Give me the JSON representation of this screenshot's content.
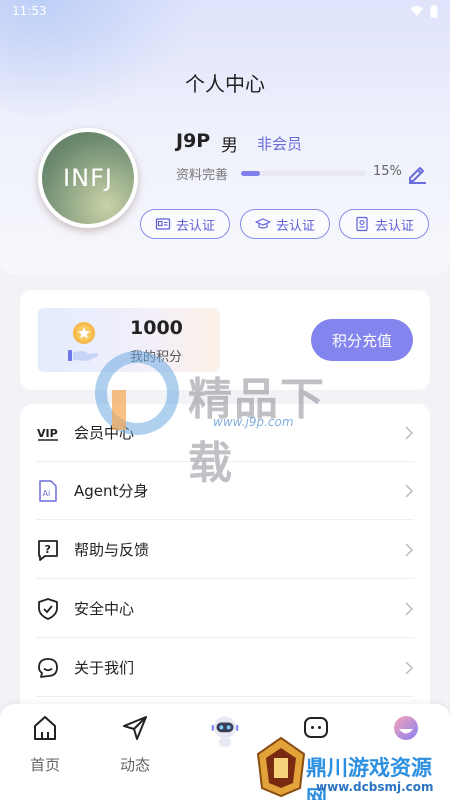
{
  "status_bar": {
    "time": "11:53"
  },
  "header": {
    "title": "个人中心"
  },
  "profile": {
    "avatar_text": "INFJ",
    "name": "J9P",
    "gender": "男",
    "member_status": "非会员",
    "completion_label": "资料完善",
    "completion_percent": 15,
    "completion_text": "15%",
    "verify_buttons": [
      {
        "label": "去认证",
        "icon": "id-card-icon"
      },
      {
        "label": "去认证",
        "icon": "graduation-cap-icon"
      },
      {
        "label": "去认证",
        "icon": "badge-icon"
      }
    ]
  },
  "points": {
    "value": "1000",
    "label": "我的积分",
    "recharge_label": "积分充值",
    "accent_color": "#8484ee"
  },
  "menu": {
    "items": [
      {
        "label": "会员中心",
        "icon": "vip-icon"
      },
      {
        "label": "Agent分身",
        "icon": "agent-icon"
      },
      {
        "label": "帮助与反馈",
        "icon": "help-icon"
      },
      {
        "label": "安全中心",
        "icon": "shield-icon"
      },
      {
        "label": "关于我们",
        "icon": "chat-smile-icon"
      }
    ]
  },
  "bottom_nav": {
    "items": [
      {
        "label": "首页",
        "icon": "home-icon"
      },
      {
        "label": "动态",
        "icon": "send-icon"
      },
      {
        "label": "",
        "icon": "robot-icon"
      },
      {
        "label": "",
        "icon": "message-icon"
      },
      {
        "label": "",
        "icon": "profile-icon"
      }
    ]
  },
  "watermark": {
    "title": "精品下载",
    "url": "www.j9p.com"
  },
  "brand_overlay": {
    "name": "鼎川游戏资源网",
    "url": "www.dcbsmj.com"
  }
}
